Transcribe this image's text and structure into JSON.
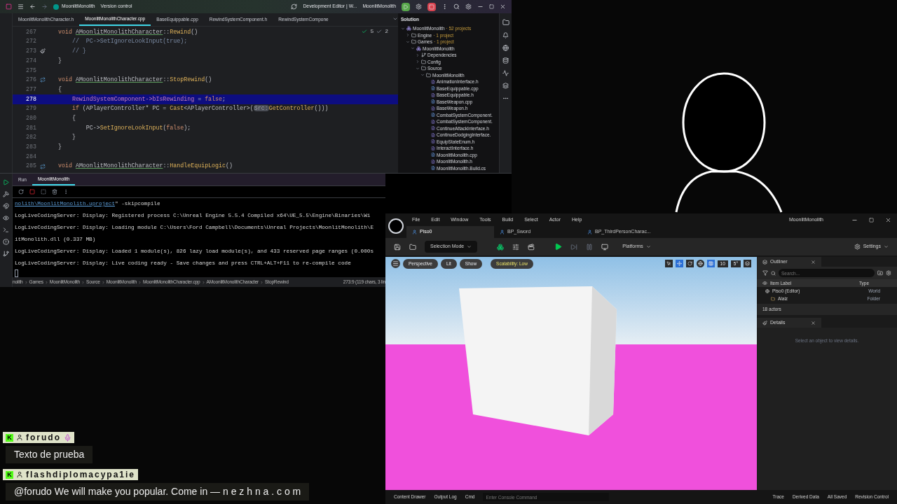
{
  "ide": {
    "project": "MoonlitMonolith",
    "version_control": "Version control",
    "configuration": "Development Editor | W...",
    "run_target": "MoonlitMonolith",
    "tabs": [
      {
        "label": "MoonlitMonolithCharacter.h",
        "selected": false
      },
      {
        "label": "MoonlitMonolithCharacter.cpp",
        "selected": true
      },
      {
        "label": "BaseEquippable.cpp",
        "selected": false
      },
      {
        "label": "RewindSystemComponent.h",
        "selected": false
      },
      {
        "label": "RewindSystemCompone",
        "selected": false
      }
    ],
    "inspections": {
      "passed": "5",
      "warnings": "2"
    },
    "code_lines": [
      {
        "number": "267",
        "selected": false,
        "tokens": [
          {
            "kind": "kw",
            "text": "void "
          },
          {
            "kind": "cls",
            "text": "AMoonlitMonolithCharacter"
          },
          {
            "kind": "plain",
            "text": "::"
          },
          {
            "kind": "fn",
            "text": "Rewind"
          },
          {
            "kind": "plain",
            "text": "()"
          }
        ]
      },
      {
        "number": "272",
        "selected": false,
        "tokens": [
          {
            "kind": "comment",
            "text": "    //  PC->SetIgnoreLookInput(true);"
          }
        ]
      },
      {
        "number": "273",
        "selected": false,
        "gutter_icon": {
          "kind": "brush"
        },
        "tokens": [
          {
            "kind": "comment",
            "text": "    // }"
          }
        ]
      },
      {
        "number": "274",
        "selected": false,
        "tokens": [
          {
            "kind": "plain",
            "text": "}"
          }
        ]
      },
      {
        "number": "275",
        "selected": false
      },
      {
        "number": "276",
        "selected": false,
        "gutter_icon": {
          "kind": "override"
        },
        "tokens": [
          {
            "kind": "kw",
            "text": "void "
          },
          {
            "kind": "cls",
            "text": "AMoonlitMonolithCharacter"
          },
          {
            "kind": "plain",
            "text": "::"
          },
          {
            "kind": "fn",
            "text": "StopRewind"
          },
          {
            "kind": "plain",
            "text": "()"
          }
        ]
      },
      {
        "number": "277",
        "selected": false,
        "tokens": [
          {
            "kind": "plain",
            "text": "{"
          }
        ]
      },
      {
        "number": "278",
        "selected": true,
        "tokens": [
          {
            "kind": "member",
            "text": "    RewindSystemComponent->bIsRewinding"
          },
          {
            "kind": "plain",
            "text": " = "
          },
          {
            "kind": "kw",
            "text": "false"
          },
          {
            "kind": "plain",
            "text": ";"
          }
        ]
      },
      {
        "number": "279",
        "selected": false,
        "tokens": [
          {
            "kind": "kw",
            "text": "    if"
          },
          {
            "kind": "plain",
            "text": " (APlayerController* PC = "
          },
          {
            "kind": "fn",
            "text": "Cast"
          },
          {
            "kind": "plain",
            "text": "<APlayerController>("
          },
          {
            "kind": "hint",
            "text": "Src:"
          },
          {
            "kind": "fn",
            "text": "GetController"
          },
          {
            "kind": "plain",
            "text": "()))"
          }
        ]
      },
      {
        "number": "280",
        "selected": false,
        "tokens": [
          {
            "kind": "plain",
            "text": "    {"
          }
        ]
      },
      {
        "number": "281",
        "selected": false,
        "tokens": [
          {
            "kind": "plain",
            "text": "        PC->"
          },
          {
            "kind": "fn",
            "text": "SetIgnoreLookInput"
          },
          {
            "kind": "plain",
            "text": "("
          },
          {
            "kind": "kw",
            "text": "false"
          },
          {
            "kind": "plain",
            "text": ");"
          }
        ]
      },
      {
        "number": "282",
        "selected": false,
        "tokens": [
          {
            "kind": "plain",
            "text": "    }"
          }
        ]
      },
      {
        "number": "283",
        "selected": false,
        "tokens": [
          {
            "kind": "plain",
            "text": "}"
          }
        ]
      },
      {
        "number": "284",
        "selected": false
      },
      {
        "number": "285",
        "selected": false,
        "gutter_icon": {
          "kind": "override"
        },
        "tokens": [
          {
            "kind": "kw",
            "text": "void "
          },
          {
            "kind": "cls",
            "text": "AMoonlitMonolithCharacter"
          },
          {
            "kind": "plain",
            "text": "::"
          },
          {
            "kind": "fn",
            "text": "HandleEquipLogic"
          },
          {
            "kind": "plain",
            "text": "()"
          }
        ]
      }
    ],
    "solution": {
      "title": "Solution",
      "tree": [
        {
          "label": "MoonlitMonolith",
          "note": "· 52 projects",
          "kind": "solution",
          "expanded": true,
          "children": [
            {
              "label": "Engine",
              "note": "· 1 project",
              "kind": "folder",
              "expanded": false
            },
            {
              "label": "Games",
              "note": "· 1 project",
              "kind": "folder",
              "expanded": true,
              "children": [
                {
                  "label": "MoonlitMonolith",
                  "kind": "project",
                  "expanded": true,
                  "children": [
                    {
                      "label": "Dependencies",
                      "kind": "deps",
                      "expanded": false
                    },
                    {
                      "label": "Config",
                      "kind": "folder",
                      "expanded": false
                    },
                    {
                      "label": "Source",
                      "kind": "folder",
                      "expanded": true,
                      "children": [
                        {
                          "label": "MoonlitMonolith",
                          "kind": "folder",
                          "expanded": true,
                          "children": [
                            {
                              "label": "AnimationInterface.h",
                              "kind": "header"
                            },
                            {
                              "label": "BaseEquippable.cpp",
                              "kind": "source"
                            },
                            {
                              "label": "BaseEquippable.h",
                              "kind": "header"
                            },
                            {
                              "label": "BaseWeapon.cpp",
                              "kind": "source"
                            },
                            {
                              "label": "BaseWeapon.h",
                              "kind": "header"
                            },
                            {
                              "label": "CombatSystemComponent.",
                              "kind": "source"
                            },
                            {
                              "label": "CombatSystemComponent.",
                              "kind": "header"
                            },
                            {
                              "label": "ContinueAttackInterface.h",
                              "kind": "header"
                            },
                            {
                              "label": "ContinueDodgingInterface.",
                              "kind": "header"
                            },
                            {
                              "label": "EquipStateEnum.h",
                              "kind": "header"
                            },
                            {
                              "label": "InteractInterface.h",
                              "kind": "header"
                            },
                            {
                              "label": "MoonlitMonolith.cpp",
                              "kind": "source"
                            },
                            {
                              "label": "MoonlitMonolith.h",
                              "kind": "header"
                            },
                            {
                              "label": "MoonlitMonolith.Build.cs",
                              "kind": "source"
                            }
                          ]
                        }
                      ]
                    }
                  ]
                }
              ]
            }
          ]
        }
      ]
    },
    "run": {
      "tabs": [
        {
          "label": "Run",
          "selected": false
        },
        {
          "label": "MoonlitMonolith",
          "selected": true
        }
      ],
      "console": [
        {
          "link": "nolith\\MoonlitMonolith.uproject",
          "text": "\" -skipcompile"
        },
        {
          "text": "LogLiveCodingServer: Display: Registered process C:\\Unreal Engine 5.5.4 Compiled x64\\UE_5.5\\Engine\\Binaries\\Wi"
        },
        {
          "text": "LogLiveCodingServer: Display: Loading module C:\\Users\\Ford Campbell\\Documents\\Unreal Projects\\MoonlitMonolith\\E"
        },
        {
          "text": "itMonolith.dll (0.337 MB)"
        },
        {
          "text": "LogLiveCodingServer: Display: Loaded 1 module(s), 826 lazy load module(s), and 433 reserved page ranges (0.000s"
        },
        {
          "text": "LogLiveCodingServer: Display: Live coding ready - Save changes and press CTRL+ALT+F11 to re-compile code"
        }
      ]
    },
    "breadcrumb": [
      "nolith",
      "Games",
      "MoonlitMonolith",
      "Source",
      "MoonlitMonolith",
      "MoonlitMonolithCharacter.cpp",
      "AMoonlitMonolithCharacter",
      "StopRewind"
    ],
    "caret_position": "273:9 (119 chars, 3 lin"
  },
  "unreal": {
    "menu": [
      "File",
      "Edit",
      "Window",
      "Tools",
      "Build",
      "Select",
      "Actor",
      "Help"
    ],
    "title": "MoonlitMonolith",
    "tabs": [
      {
        "label": "Piso0",
        "selected": true
      },
      {
        "label": "BP_Sword",
        "selected": false
      },
      {
        "label": "BP_ThirdPersonCharac...",
        "selected": false
      }
    ],
    "selection_mode": "Selection Mode",
    "platforms": "Platforms",
    "settings": "Settings",
    "viewport": {
      "perspective": "Perspective",
      "lit": "Lit",
      "show": "Show",
      "scalability": "Scalability: Low",
      "grid_snap": "10",
      "rotation_snap": "5°"
    },
    "outliner": {
      "title": "Outliner",
      "search_placeholder": "Search...",
      "columns": [
        "Item Label",
        "Type"
      ],
      "rows": [
        {
          "label": "Piso0 (Editor)",
          "type": "World",
          "kind": "world"
        },
        {
          "label": "Alaiz",
          "type": "Folder",
          "kind": "folder"
        }
      ],
      "count": "18 actors"
    },
    "details": {
      "title": "Details",
      "empty": "Select an object to view details."
    },
    "status": {
      "content_drawer": "Content Drawer",
      "output_log": "Output Log",
      "cmd": "Cmd",
      "console_placeholder": "Enter Console Command",
      "trace": "Trace",
      "derived_data": "Derived Data",
      "saved": "All Saved",
      "revision_control": "Revision Control"
    }
  },
  "chat": [
    {
      "badge": "K",
      "user": "forudo",
      "mic": true,
      "text": "Texto de prueba"
    },
    {
      "badge": "K",
      "user": "flashdiplomacypa1ie",
      "mic": false,
      "text": "@forudo We will make you popular. Come in — n e z h n a . c o m"
    }
  ]
}
